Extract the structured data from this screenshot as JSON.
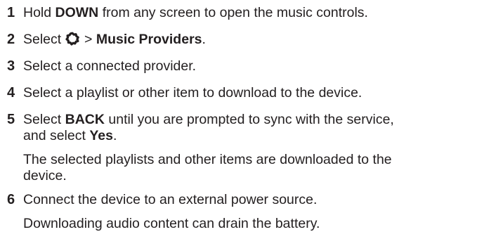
{
  "steps": [
    {
      "number": "1",
      "before": "Hold ",
      "bold": "DOWN",
      "after": " from any screen to open the music controls."
    },
    {
      "number": "2",
      "before": "Select ",
      "icon": "gear-icon",
      "middle": " > ",
      "bold": "Music Providers",
      "after": "."
    },
    {
      "number": "3",
      "text": "Select a connected provider."
    },
    {
      "number": "4",
      "text": "Select a playlist or other item to download to the device."
    },
    {
      "number": "5",
      "before": "Select ",
      "bold": "BACK",
      "after": " until you are prompted to sync with the service,",
      "line2_before": "and select ",
      "line2_bold": "Yes",
      "line2_after": ".",
      "note_line1": "The selected playlists and other items are downloaded to the",
      "note_line2": "device."
    },
    {
      "number": "6",
      "text": "Connect the device to an external power source.",
      "note": "Downloading audio content can drain the battery."
    }
  ]
}
